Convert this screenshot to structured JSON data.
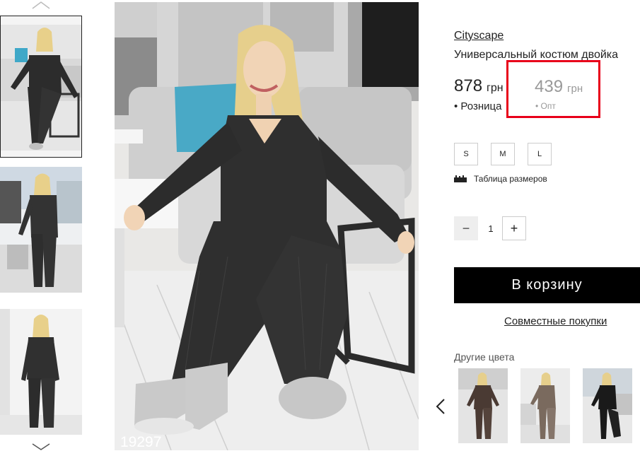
{
  "gallery": {
    "prev_icon": "chevron-up-icon",
    "next_icon": "chevron-down-icon",
    "thumbnails": [
      "thumbnail-1",
      "thumbnail-2",
      "thumbnail-3"
    ],
    "photo_code": "19297"
  },
  "product": {
    "brand": "Cityscape",
    "title": "Универсальный костюм двойка",
    "retail_price": "878",
    "retail_currency": "грн",
    "retail_label": "• Розница",
    "wholesale_price": "439",
    "wholesale_currency": "грн",
    "wholesale_label": "• Опт"
  },
  "sizes": [
    "S",
    "M",
    "L"
  ],
  "size_table": {
    "icon": "ruler-icon",
    "label": "Таблица размеров"
  },
  "quantity": {
    "minus": "−",
    "value": "1",
    "plus": "+"
  },
  "cart_button": "В корзину",
  "joint_purchase": "Совместные покупки",
  "other_colors": {
    "label": "Другие цвета",
    "prev_icon": "chevron-left-icon",
    "items": [
      "brown-variant",
      "beige-variant",
      "black-variant"
    ]
  },
  "colors": {
    "highlight": "#e8001a",
    "cart_bg": "#000000",
    "muted_price": "#999999"
  }
}
